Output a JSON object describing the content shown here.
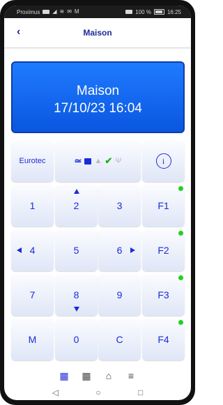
{
  "statusbar": {
    "carrier": "Proximus",
    "battery_text": "100 %",
    "time": "16:25"
  },
  "header": {
    "back_glyph": "‹",
    "title": "Maison"
  },
  "display": {
    "line1": "Maison",
    "line2": "17/10/23  16:04",
    "color": "#0a64f0"
  },
  "keypad": {
    "eurotec_label": "Eurotec",
    "status_icons": [
      "≃",
      "🔓",
      "🔔",
      "✔",
      "📶"
    ],
    "info_glyph": "i",
    "keys": {
      "k1": "1",
      "k2": "2",
      "k3": "3",
      "f1": "F1",
      "k4": "4",
      "k5": "5",
      "k6": "6",
      "f2": "F2",
      "k7": "7",
      "k8": "8",
      "k9": "9",
      "f3": "F3",
      "m": "M",
      "k0": "0",
      "c": "C",
      "f4": "F4"
    },
    "indicator_color": "#22d01f"
  },
  "bottom_tabs": [
    {
      "icon": "keypad-icon",
      "glyph": "▦"
    },
    {
      "icon": "grid-icon",
      "glyph": "▦"
    },
    {
      "icon": "home-icon",
      "glyph": "⌂"
    },
    {
      "icon": "menu-icon",
      "glyph": "≡"
    }
  ],
  "navbar": {
    "back": "◁",
    "home": "○",
    "recent": "□"
  }
}
